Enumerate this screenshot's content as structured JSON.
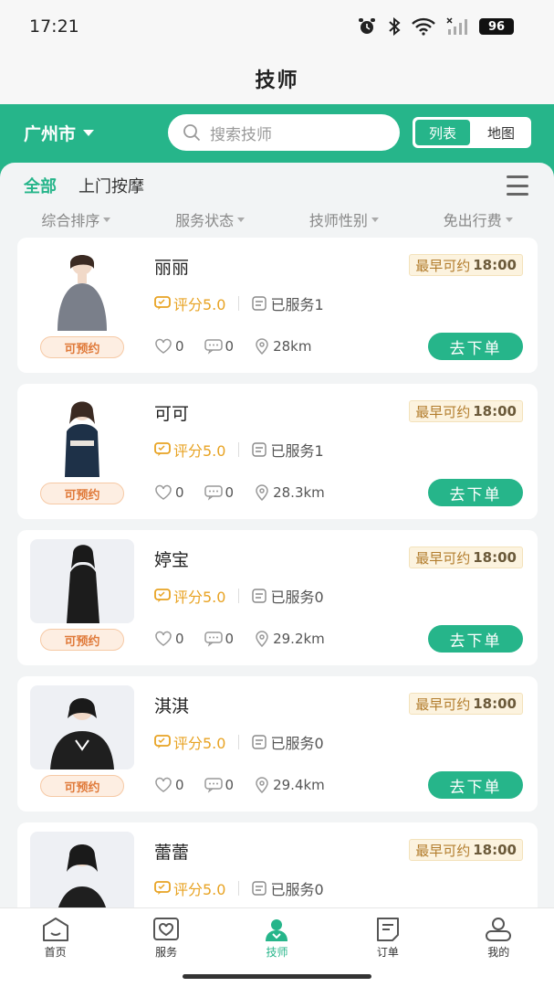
{
  "status_bar": {
    "time": "17:21",
    "battery": "96"
  },
  "page_title": "技师",
  "header": {
    "city": "广州市",
    "search_placeholder": "搜索技师",
    "view_toggle": {
      "list": "列表",
      "map": "地图",
      "active": "list"
    }
  },
  "tabs": [
    {
      "label": "全部",
      "active": true
    },
    {
      "label": "上门按摩",
      "active": false
    }
  ],
  "filters": [
    "综合排序",
    "服务状态",
    "技师性别",
    "免出行费"
  ],
  "therapists": [
    {
      "name": "丽丽",
      "status": "可预约",
      "earliest_label": "最早可约",
      "earliest_time": "18:00",
      "rating": "评分5.0",
      "served": "已服务1",
      "likes": "0",
      "comments": "0",
      "distance": "28km",
      "order_label": "去下单"
    },
    {
      "name": "可可",
      "status": "可预约",
      "earliest_label": "最早可约",
      "earliest_time": "18:00",
      "rating": "评分5.0",
      "served": "已服务1",
      "likes": "0",
      "comments": "0",
      "distance": "28.3km",
      "order_label": "去下单"
    },
    {
      "name": "婷宝",
      "status": "可预约",
      "earliest_label": "最早可约",
      "earliest_time": "18:00",
      "rating": "评分5.0",
      "served": "已服务0",
      "likes": "0",
      "comments": "0",
      "distance": "29.2km",
      "order_label": "去下单"
    },
    {
      "name": "淇淇",
      "status": "可预约",
      "earliest_label": "最早可约",
      "earliest_time": "18:00",
      "rating": "评分5.0",
      "served": "已服务0",
      "likes": "0",
      "comments": "0",
      "distance": "29.4km",
      "order_label": "去下单"
    },
    {
      "name": "蕾蕾",
      "earliest_label": "最早可约",
      "earliest_time": "18:00",
      "rating": "评分5.0",
      "served": "已服务0"
    }
  ],
  "bottom_nav": [
    {
      "label": "首页",
      "icon": "home-icon",
      "active": false
    },
    {
      "label": "服务",
      "icon": "service-icon",
      "active": false
    },
    {
      "label": "技师",
      "icon": "therapist-icon",
      "active": true
    },
    {
      "label": "订单",
      "icon": "order-icon",
      "active": false
    },
    {
      "label": "我的",
      "icon": "profile-icon",
      "active": false
    }
  ],
  "colors": {
    "primary": "#26b58a",
    "available": "#e07a3a",
    "rating": "#e8a323"
  }
}
